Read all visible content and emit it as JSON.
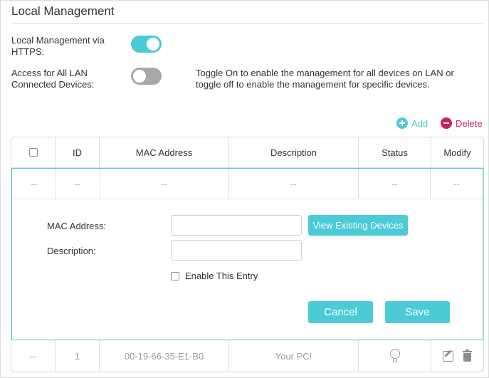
{
  "section": {
    "title": "Local Management"
  },
  "settings": {
    "https": {
      "label": "Local Management via HTTPS:",
      "state": "on"
    },
    "all_lan": {
      "label": "Access for All LAN Connected Devices:",
      "state": "off",
      "help": "Toggle On to enable the management for all devices on LAN or toggle off to enable the management for specific devices."
    }
  },
  "actions": {
    "add_label": "Add",
    "delete_label": "Delete"
  },
  "table": {
    "headers": {
      "id": "ID",
      "mac": "MAC Address",
      "description": "Description",
      "status": "Status",
      "modify": "Modify"
    },
    "placeholder_row": {
      "select": "--",
      "id": "--",
      "mac": "--",
      "description": "--",
      "status": "--",
      "modify": "--"
    },
    "rows": [
      {
        "select": "--",
        "id": "1",
        "mac": "00-19-66-35-E1-B0",
        "description": "Your PC!",
        "status_icon": "lightbulb-icon"
      }
    ]
  },
  "form": {
    "mac_label": "MAC Address:",
    "mac_value": "",
    "description_label": "Description:",
    "description_value": "",
    "view_devices_label": "View Existing Devices",
    "enable_label": "Enable This Entry",
    "cancel_label": "Cancel",
    "save_label": "Save"
  },
  "colors": {
    "accent": "#4acbd6",
    "delete": "#c3245e",
    "toggle_off": "#a8a8a8"
  }
}
